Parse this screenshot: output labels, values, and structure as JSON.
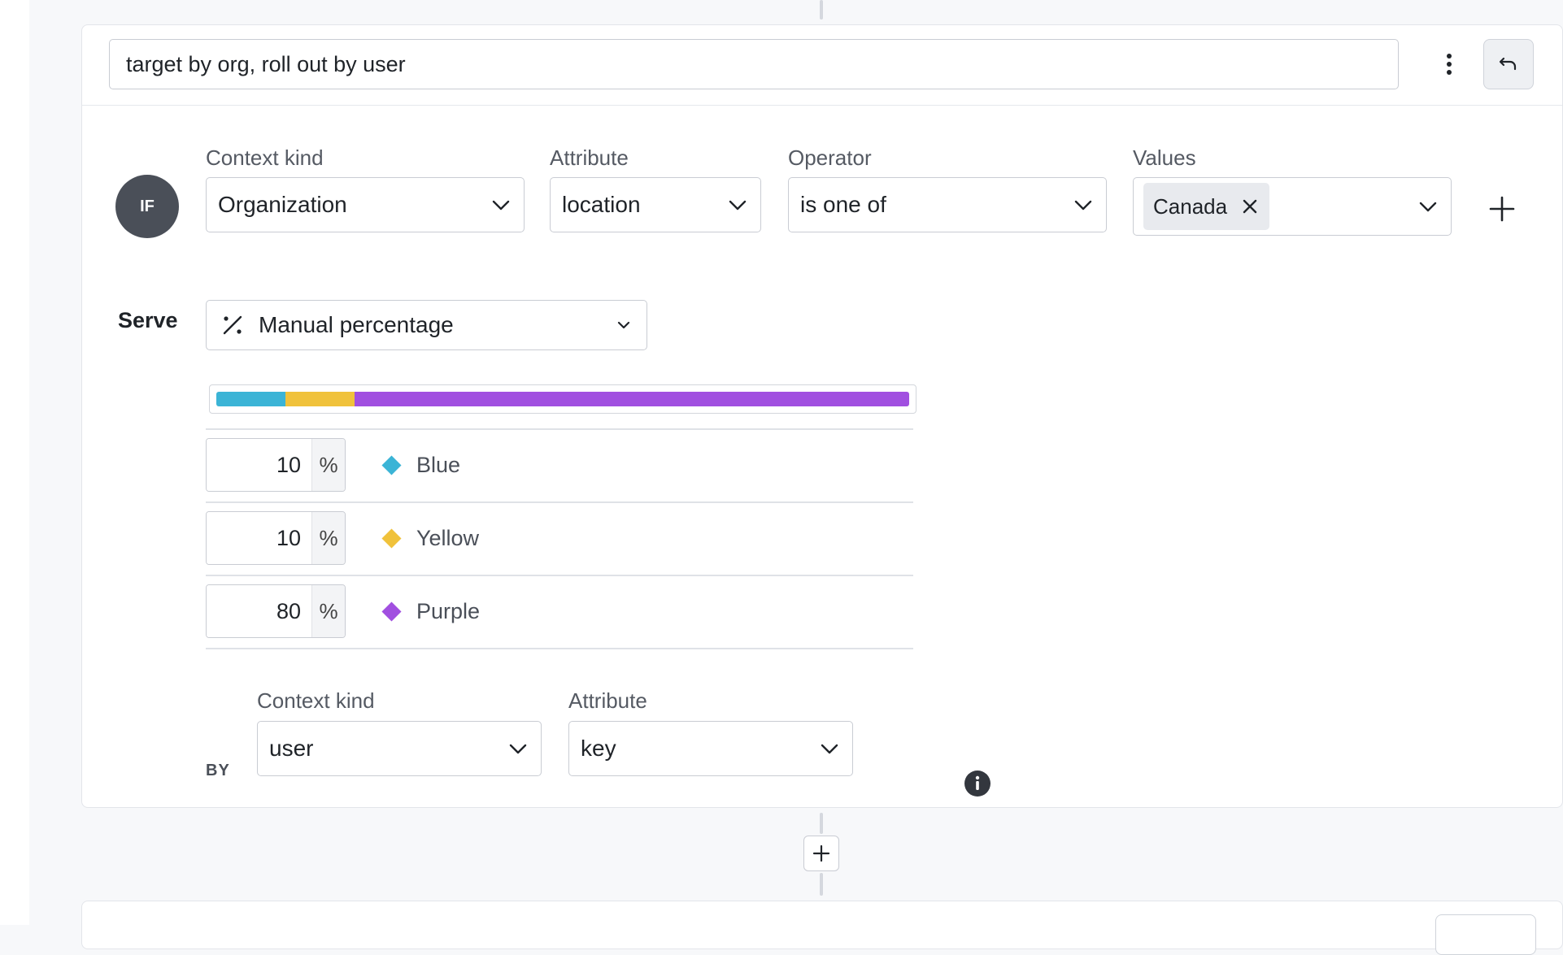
{
  "rule": {
    "name": "target by org, roll out by user",
    "menu_icon": "kebab-icon",
    "undo_icon": "undo-icon"
  },
  "clause": {
    "if_label": "IF",
    "context_kind_label": "Context kind",
    "context_kind_value": "Organization",
    "attribute_label": "Attribute",
    "attribute_value": "location",
    "operator_label": "Operator",
    "operator_value": "is one of",
    "values_label": "Values",
    "values": [
      "Canada"
    ],
    "add_icon": "plus-icon"
  },
  "serve": {
    "label": "Serve",
    "mode": "Manual percentage",
    "mode_icon": "percent-icon",
    "variations": [
      {
        "name": "Blue",
        "percent": "10",
        "color": "#3bb4d6"
      },
      {
        "name": "Yellow",
        "percent": "10",
        "color": "#f0c23b"
      },
      {
        "name": "Purple",
        "percent": "80",
        "color": "#a14fe0"
      }
    ],
    "percent_sign": "%"
  },
  "bucket_by": {
    "label": "BY",
    "context_kind_label": "Context kind",
    "context_kind_value": "user",
    "attribute_label": "Attribute",
    "attribute_value": "key",
    "info_icon": "info-icon"
  },
  "add_rule_icon": "plus-icon"
}
